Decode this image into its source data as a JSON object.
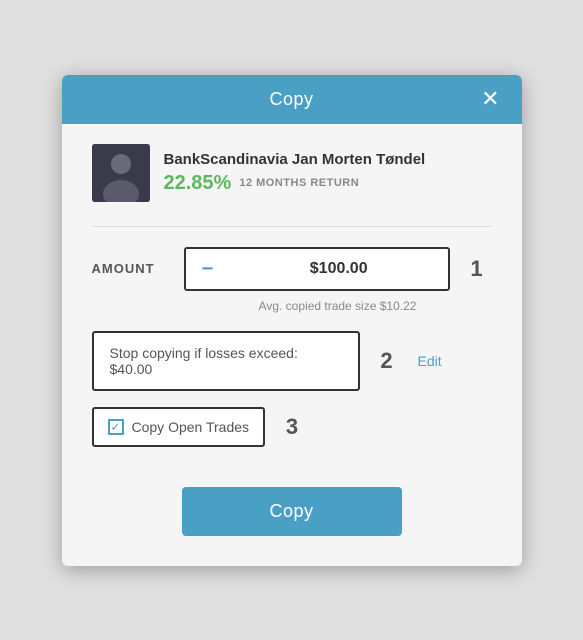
{
  "modal": {
    "title": "Copy",
    "close_label": "✕"
  },
  "trader": {
    "name": "BankScandinavia Jan Morten Tøndel",
    "return_percent": "22.85%",
    "return_label": "12 MONTHS RETURN"
  },
  "amount_section": {
    "label": "AMOUNT",
    "value": "$100.00",
    "minus_label": "−",
    "plus_label": "+",
    "avg_text": "Avg. copied trade size $10.22",
    "step_number": "1"
  },
  "stop_loss": {
    "text": "Stop copying if losses exceed: $40.00",
    "step_number": "2",
    "edit_label": "Edit"
  },
  "copy_trades": {
    "label": "Copy Open Trades",
    "checked": true,
    "step_number": "3"
  },
  "copy_button": {
    "label": "Copy"
  }
}
